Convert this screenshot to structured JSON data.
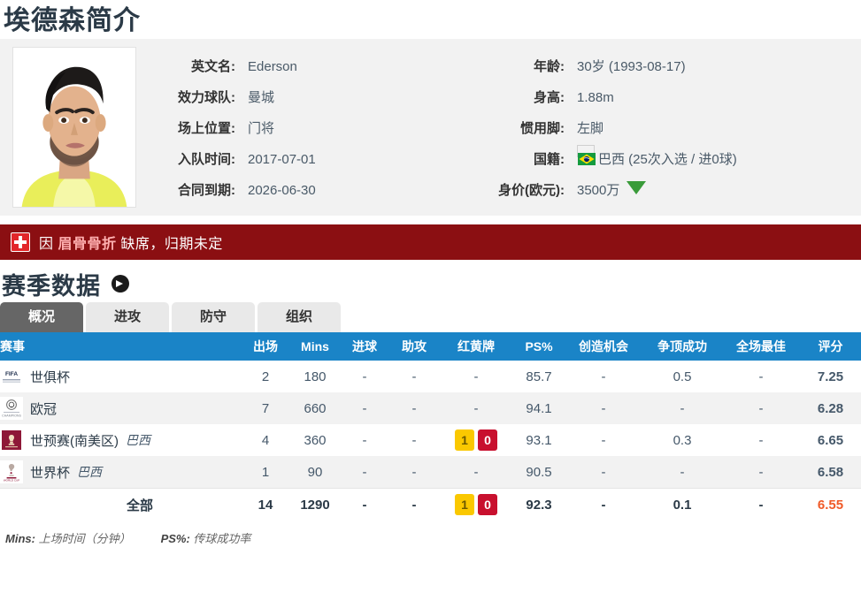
{
  "page_title": "埃德森简介",
  "profile": {
    "photo_alt": "player-photo",
    "left_fields": [
      {
        "label": "英文名:",
        "value": "Ederson"
      },
      {
        "label": "效力球队:",
        "value": "曼城"
      },
      {
        "label": "场上位置:",
        "value": "门将"
      },
      {
        "label": "入队时间:",
        "value": "2017-07-01"
      },
      {
        "label": "合同到期:",
        "value": "2026-06-30"
      }
    ],
    "right_fields": [
      {
        "label": "年龄:",
        "value": "30岁  (1993-08-17)"
      },
      {
        "label": "身高:",
        "value": "1.88m"
      },
      {
        "label": "惯用脚:",
        "value": "左脚"
      },
      {
        "label": "国籍:",
        "value": "巴西 (25次入选 / 进0球)",
        "flag": "brazil-flag"
      },
      {
        "label": "身价(欧元):",
        "value": "3500万",
        "trend": "down"
      }
    ]
  },
  "injury": {
    "icon": "medical-cross-icon",
    "prefix": "因 ",
    "reason": "眉骨骨折",
    "suffix": " 缺席，归期未定",
    "color": "#8b0f12"
  },
  "season_section": {
    "title": "赛季数据",
    "more_icon": "arrow-right-circle-icon",
    "tabs": [
      {
        "label": "概况",
        "active": true
      },
      {
        "label": "进攻",
        "active": false
      },
      {
        "label": "防守",
        "active": false
      },
      {
        "label": "组织",
        "active": false
      }
    ]
  },
  "chart_data": {
    "type": "table",
    "title": "赛季数据 - 概况",
    "columns": [
      "赛事",
      "出场",
      "Mins",
      "进球",
      "助攻",
      "红黄牌",
      "PS%",
      "创造机会",
      "争顶成功",
      "全场最佳",
      "评分"
    ],
    "rows": [
      {
        "icon": "fifa-club-world-cup-icon",
        "competition": "世俱杯",
        "nation": "",
        "appearances": "2",
        "mins": "180",
        "goals": "-",
        "assists": "-",
        "cards": null,
        "cards_dash": "-",
        "ps_pct": "85.7",
        "chances_created": "-",
        "aerials_won": "0.5",
        "mom": "-",
        "rating": "7.25"
      },
      {
        "icon": "uefa-champions-league-icon",
        "competition": "欧冠",
        "nation": "",
        "appearances": "7",
        "mins": "660",
        "goals": "-",
        "assists": "-",
        "cards": null,
        "cards_dash": "-",
        "ps_pct": "94.1",
        "chances_created": "-",
        "aerials_won": "-",
        "mom": "-",
        "rating": "6.28"
      },
      {
        "icon": "world-cup-qualifier-icon",
        "competition": "世预赛(南美区)",
        "nation": "巴西",
        "appearances": "4",
        "mins": "360",
        "goals": "-",
        "assists": "-",
        "cards": {
          "yellow": "1",
          "red": "0"
        },
        "cards_dash": "",
        "ps_pct": "93.1",
        "chances_created": "-",
        "aerials_won": "0.3",
        "mom": "-",
        "rating": "6.65"
      },
      {
        "icon": "world-cup-icon",
        "competition": "世界杯",
        "nation": "巴西",
        "appearances": "1",
        "mins": "90",
        "goals": "-",
        "assists": "-",
        "cards": null,
        "cards_dash": "-",
        "ps_pct": "90.5",
        "chances_created": "-",
        "aerials_won": "-",
        "mom": "-",
        "rating": "6.58"
      }
    ],
    "total_row": {
      "competition": "全部",
      "appearances": "14",
      "mins": "1290",
      "goals": "-",
      "assists": "-",
      "cards": {
        "yellow": "1",
        "red": "0"
      },
      "ps_pct": "92.3",
      "chances_created": "-",
      "aerials_won": "0.1",
      "mom": "-",
      "rating": "6.55"
    },
    "accent_header_color": "#1a84c7",
    "rating_color": "#f05a28"
  },
  "footnote": {
    "mins_key": "Mins:",
    "mins_desc": " 上场时间（分钟）",
    "ps_key": "PS%:",
    "ps_desc": " 传球成功率"
  }
}
